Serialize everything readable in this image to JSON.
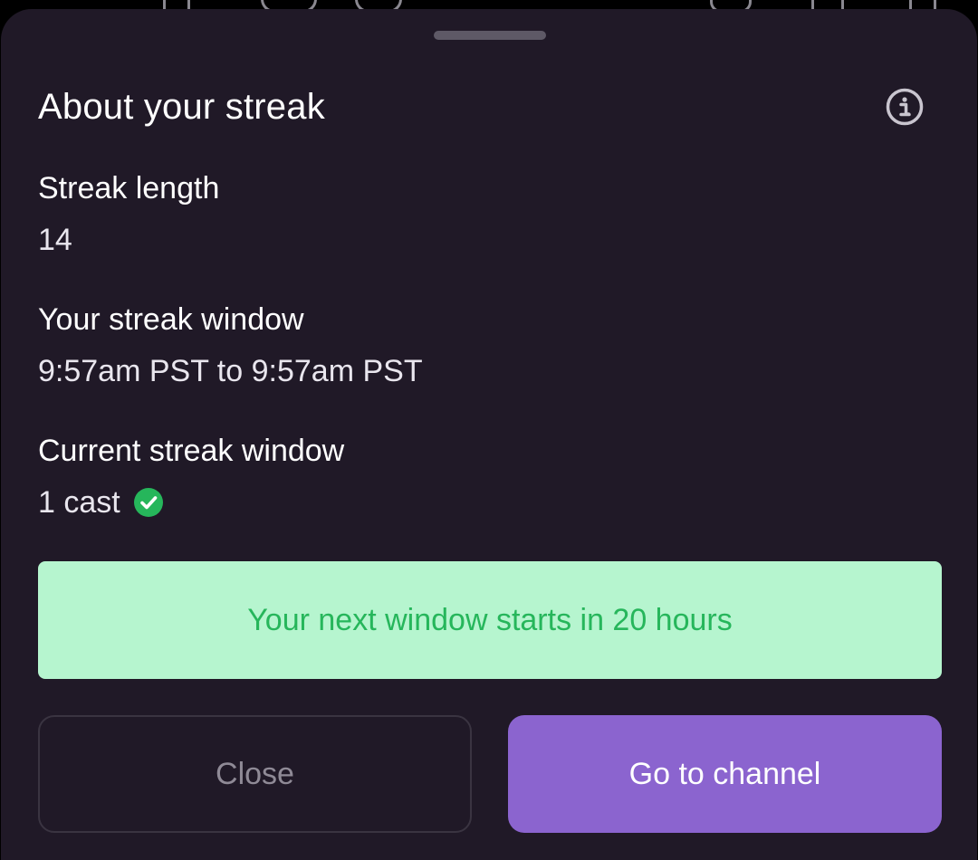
{
  "sheet": {
    "title": "About your streak",
    "info_icon": "info-circle-icon"
  },
  "fields": [
    {
      "label": "Streak length",
      "value": "14"
    },
    {
      "label": "Your streak window",
      "value": "9:57am PST to 9:57am PST"
    },
    {
      "label": "Current streak window",
      "value": "1 cast",
      "status_icon": "check-circle-icon"
    }
  ],
  "notice": {
    "text": "Your next window starts in 20 hours"
  },
  "buttons": {
    "close_label": "Close",
    "go_label": "Go to channel"
  },
  "colors": {
    "sheet_background": "#201927",
    "accent": "#8b64cf",
    "success": "#26b65b",
    "notice_background": "#b6f5cf"
  }
}
